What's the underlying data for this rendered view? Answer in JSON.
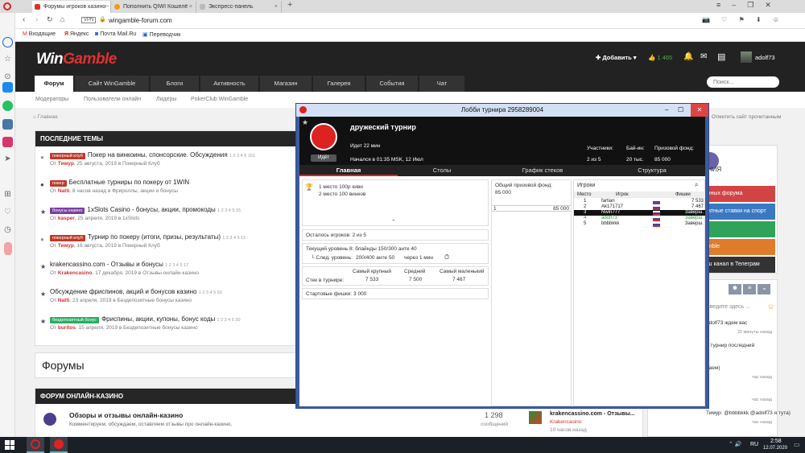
{
  "browser": {
    "tabs": [
      {
        "title": "Форумы игроков казино -",
        "active": true,
        "fav_color": "#d9342b"
      },
      {
        "title": "Пополнить QIWI Кошелё",
        "active": false,
        "fav_color": "#f29a1a"
      },
      {
        "title": "Экспресс-панель",
        "active": false,
        "fav_color": "#bbbbbb"
      }
    ],
    "url_badge": "VPN",
    "url": "wingamble-forum.com",
    "bookmarks": [
      "Входящие",
      "Яндекс",
      "Почта Mail.Ru",
      "Переводчик"
    ]
  },
  "site": {
    "logo_main": "Win",
    "logo_accent": "Gamble",
    "add_label": "Добавить",
    "likes": "1 465",
    "username": "adolf73",
    "search_placeholder": "Поиск...",
    "nav": [
      "Форум",
      "Сайт WinGamble",
      "Блоги",
      "Активность",
      "Магазин",
      "Галерея",
      "События",
      "Чат"
    ],
    "subnav": [
      "Модераторы",
      "Пользователи онлайн",
      "Лидеры",
      "PokerClub WinGamble"
    ],
    "breadcrumb": "Главная",
    "mark_read": "Отметить сайт прочитанным",
    "latest_title": "ПОСЛЕДНИЕ ТЕМЫ",
    "topics": [
      {
        "tag": "покерный клуб",
        "tag_color": "#c0392b",
        "title": "Покер на винкоины, спонсорские. Обсуждения",
        "pages": "1 2 3 4 5 151",
        "author": "Тимур",
        "meta": ", 25 августа, 2019 в Покерный Клуб",
        "icon": "●",
        "icon_color": "#999"
      },
      {
        "tag": "покер",
        "tag_color": "#c0392b",
        "title": "Бесплатные турниры по покеру от 1WIN",
        "pages": "",
        "author": "Natti",
        "meta": ", 8 часов назад в Фрироллы, акции и бонусы",
        "icon": "●",
        "icon_color": "#4a3f8c"
      },
      {
        "tag": "бонусы казино",
        "tag_color": "#7b3fa0",
        "title": "1xSlots Casino - бонусы, акции, промокоды",
        "pages": "1 2 3 4 5 15",
        "author": "kasper",
        "meta": ", 25 апреля, 2019 в 1xSlots",
        "icon": "★",
        "icon_color": "#4a3f8c"
      },
      {
        "tag": "покерный клуб",
        "tag_color": "#c0392b",
        "title": "Турнир по покеру (итоги, призы, результаты)",
        "pages": "1 2 3 4 5 11",
        "author": "Тимур",
        "meta": ", 16 августа, 2019 в Покерный Клуб",
        "icon": "●",
        "icon_color": "#999"
      },
      {
        "tag": "",
        "tag_color": "",
        "title": "krakencassino.com - Отзывы и бонусы",
        "pages": "1 2 3 4 5 17",
        "author": "Krakencasino",
        "meta": ", 17 декабря, 2019 в Отзывы онлайн-казино",
        "icon": "★",
        "icon_color": "#4a3f8c"
      },
      {
        "tag": "",
        "tag_color": "",
        "title": "Обсуждение фриспинов, акций и бонусов казино",
        "pages": "1 2 3 4 5 50",
        "author": "Natti",
        "meta": ", 23 апреля, 2019 в Бездепозитные бонусы казино",
        "icon": "★",
        "icon_color": "#4a3f8c"
      },
      {
        "tag": "бездепозитный бонус",
        "tag_color": "#27ae60",
        "title": "Фриспины, акции, купоны, бонус коды",
        "pages": "1 2 3 4 5 30",
        "author": "buritos",
        "meta": ", 15 апреля, 2019 в Бездепозитные бонусы казино",
        "icon": "★",
        "icon_color": "#4a3f8c"
      }
    ],
    "forums_title": "Форумы",
    "forum_online_title": "ФОРУМ ОНЛАЙН-КАЗИНО",
    "forum_row": {
      "title": "Обзоры и отзывы онлайн-казино",
      "desc": "Комментируем, обсуждаем, оставляем отзывы про онлайн-казино.",
      "count": "1 298",
      "count_label": "сообщений",
      "last_title": "krakencassino.com - Отзывы...",
      "last_author": "Krakencasino",
      "last_time": "10 часов назад"
    },
    "right_buttons": [
      {
        "label": "ичных форума",
        "color": "#d34343"
      },
      {
        "label": "латные ставки на спорт",
        "color": "#3a78c2"
      },
      {
        "label": "",
        "color": "#2fa35a"
      },
      {
        "label": "amble",
        "color": "#e07b2c"
      },
      {
        "label": "аш канал в Телеграм",
        "color": "#333"
      }
    ],
    "right_promo": "ВЛЕНИЯ",
    "chat_placeholder": "Введите здесь ...",
    "chat": [
      {
        "text": "adolf73 ждем вас",
        "time": "32 минуты назад"
      },
      {
        "text": "1 турнир последний",
        "time": ""
      },
      {
        "text": "раем)",
        "time": "час назад"
      },
      {
        "text": "",
        "time": "час назад"
      },
      {
        "text": "Тимур: @bbbbkkk @adolf73 я тута)",
        "time": "час назад"
      }
    ]
  },
  "lobby": {
    "window_title": "Лобби турнира 2958289004",
    "name": "дружеский турнир",
    "status_badge": "Идёт",
    "running": "Идет 22 мин",
    "started": "Началcя в 01:35 MSK, 12 Июл",
    "stats_labels": [
      "Участники:",
      "Бай-ин:",
      "Призовой фонд:"
    ],
    "stats_values": [
      "2 из 5",
      "20 тыс.",
      "85 000"
    ],
    "tabs": [
      "Главная",
      "Столы",
      "График стеков",
      "Структура"
    ],
    "prizes": [
      "1 место 100р киви",
      "2 место 100 винков"
    ],
    "players_left": "Осталось игроков: 2 из 5",
    "level_line": "Текущий уровень 8: блайнды 150/300 анте 40",
    "next_level_label": "└ След. уровень:",
    "next_level": "200/400 анте 50",
    "next_in": "через 1 мин",
    "stack_headers": [
      "Самый крупный",
      "Средний",
      "Самый маленький"
    ],
    "stack_label": "Стек в турнире:",
    "stack_values": [
      "7 533",
      "7 500",
      "7 467"
    ],
    "start_chips": "Стартовые фишки: 3 000",
    "prize_pool_label": "Общий призовой фонд:",
    "prize_pool": "85 000",
    "prize_place": "1",
    "prize_amount": "85 000",
    "players_title": "Игроки",
    "players_headers": [
      "Место",
      "Игрок",
      "Фишки"
    ],
    "players": [
      {
        "place": "1",
        "name": "fartian",
        "chips": "7 533",
        "selected": false,
        "green": false
      },
      {
        "place": "2",
        "name": "Ak171717",
        "chips": "7 467",
        "selected": false,
        "green": false
      },
      {
        "place": "3",
        "name": "Nwin777",
        "chips": "Заверш.",
        "selected": true,
        "green": false
      },
      {
        "place": "4",
        "name": "adolf73",
        "chips": "Заверш.",
        "selected": false,
        "green": true
      },
      {
        "place": "5",
        "name": "bbbbkkk",
        "chips": "Заверш.",
        "selected": false,
        "green": false
      }
    ]
  },
  "taskbar": {
    "lang": "RU",
    "time": "2:58",
    "date": "12.07.2020"
  }
}
